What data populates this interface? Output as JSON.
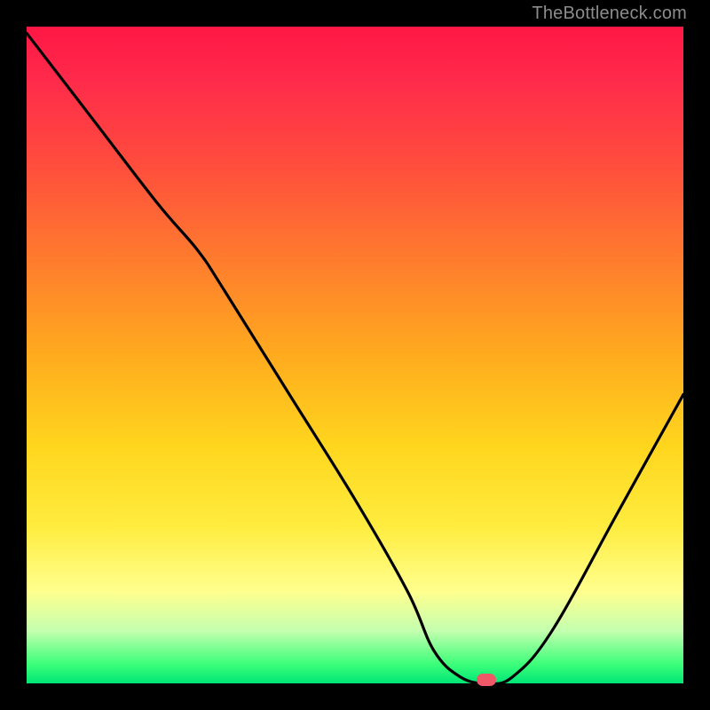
{
  "watermark": "TheBottleneck.com",
  "chart_data": {
    "type": "line",
    "title": "",
    "xlabel": "",
    "ylabel": "",
    "xlim": [
      0,
      100
    ],
    "ylim": [
      0,
      100
    ],
    "background_gradient": [
      "#ff1744",
      "#ff7a2e",
      "#ffd61e",
      "#ffff8e",
      "#00e676"
    ],
    "series": [
      {
        "name": "bottleneck-curve",
        "x": [
          0,
          10,
          20,
          26,
          30,
          40,
          50,
          58,
          62,
          66,
          70,
          74,
          80,
          90,
          100
        ],
        "y": [
          99,
          86,
          73,
          66,
          60,
          44,
          28,
          14,
          5,
          1,
          0,
          1,
          8,
          26,
          44
        ]
      }
    ],
    "marker": {
      "x": 70,
      "y": 0,
      "color": "#ef5867"
    }
  }
}
